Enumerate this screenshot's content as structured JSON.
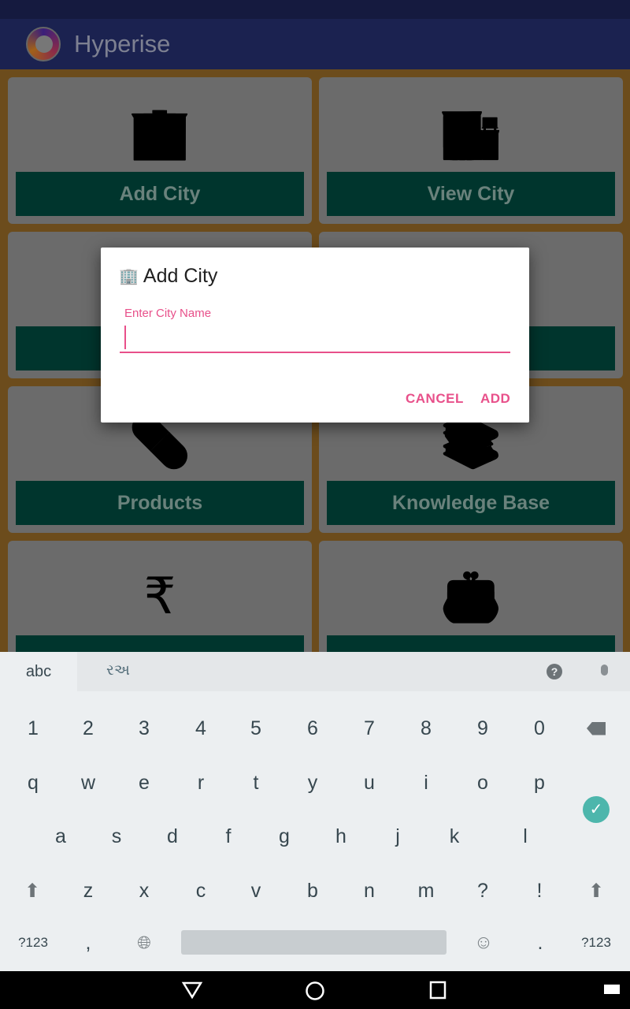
{
  "app": {
    "title": "Hyperise"
  },
  "tiles": [
    {
      "label": "Add City",
      "icon": "building-add-icon"
    },
    {
      "label": "View City",
      "icon": "building-icon"
    },
    {
      "label": "",
      "icon": ""
    },
    {
      "label": "",
      "icon": ""
    },
    {
      "label": "Products",
      "icon": "pills-icon"
    },
    {
      "label": "Knowledge Base",
      "icon": "books-icon"
    },
    {
      "label": "",
      "icon": "rupee-icon"
    },
    {
      "label": "",
      "icon": "wallet-icon"
    }
  ],
  "dialog": {
    "title": "Add City",
    "field_label": "Enter City Name",
    "field_value": "",
    "cancel": "CANCEL",
    "add": "ADD"
  },
  "keyboard": {
    "tab_abc": "abc",
    "tab_gujarati": "રઅ",
    "row_numbers": [
      "1",
      "2",
      "3",
      "4",
      "5",
      "6",
      "7",
      "8",
      "9",
      "0"
    ],
    "row_q": [
      "q",
      "w",
      "e",
      "r",
      "t",
      "y",
      "u",
      "i",
      "o",
      "p"
    ],
    "row_a": [
      "a",
      "s",
      "d",
      "f",
      "g",
      "h",
      "j",
      "k",
      "l"
    ],
    "row_z": [
      "z",
      "x",
      "c",
      "v",
      "b",
      "n",
      "m",
      "?",
      "!"
    ],
    "symbols_label": "?123",
    "comma": ",",
    "period": "."
  },
  "colors": {
    "accent": "#e8508a",
    "tile_button": "#00695c",
    "app_bar": "#283593",
    "check": "#4db6ac"
  }
}
